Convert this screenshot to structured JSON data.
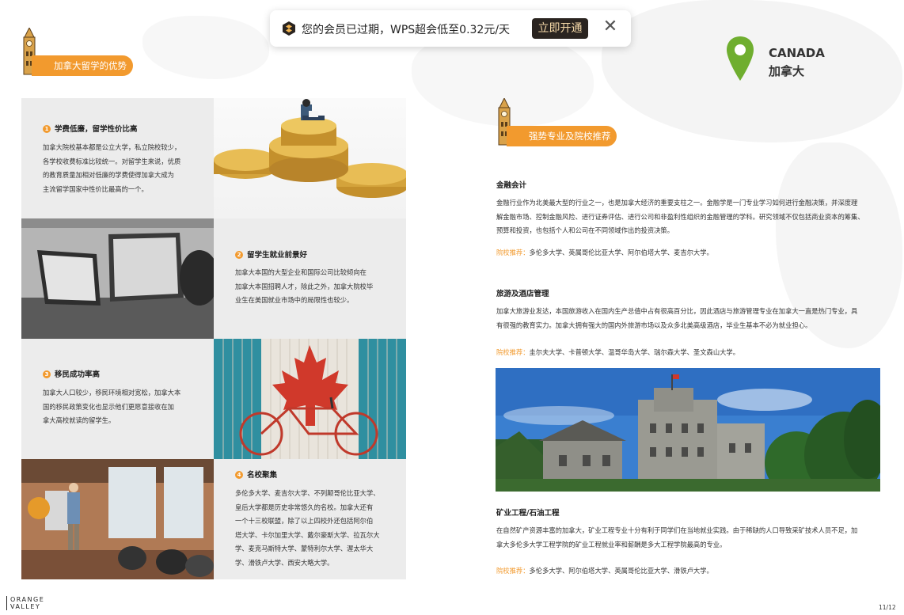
{
  "notification": {
    "message": "您的会员已过期，WPS超会低至0.32元/天",
    "action_label": "立即开通",
    "close_glyph": "✕"
  },
  "left_header": {
    "title": "加拿大留学的优势"
  },
  "advantages": [
    {
      "num": "1",
      "title": "学费低廉，留学性价比高",
      "body_lines": [
        "加拿大院校基本都是公立大学，私立院校较少，",
        "各学校收费标准比较统一。对留学生来说，优质",
        "的教育质量加相对低廉的学费使得加拿大成为",
        "主流留学国家中性价比最高的一个。"
      ]
    },
    {
      "num": "2",
      "title": "留学生就业前景好",
      "body_lines": [
        "加拿大本国的大型企业和国际公司比较倾向在",
        "加拿大本国招聘人才，除此之外，加拿大院校毕",
        "业生在美国就业市场中的局限性也较少。"
      ]
    },
    {
      "num": "3",
      "title": "移民成功率高",
      "body_lines": [
        "加拿大人口较少，移民环境相对宽松，加拿大本",
        "国的移民政策变化也显示他们更愿意接收在加",
        "拿大高校就读的留学生。"
      ]
    },
    {
      "num": "4",
      "title": "名校聚集",
      "body_lines": [
        "多伦多大学、麦吉尔大学、不列颠哥伦比亚大学、",
        "皇后大学都是历史非常悠久的名校。加拿大还有",
        "一个十三校联盟，除了以上四校外还包括阿尔伯",
        "塔大学、卡尔加里大学、戴尔豪斯大学、拉瓦尔大",
        "学、麦克马斯特大学、蒙特利尔大学、渥太华大",
        "学、滑铁卢大学、西安大略大学。"
      ]
    }
  ],
  "canada": {
    "en": "CANADA",
    "cn": "加拿大"
  },
  "right_header": {
    "title": "强势专业及院校推荐"
  },
  "majors": [
    {
      "title": "金融会计",
      "body_lines": [
        "金融行业作为北美最大型的行业之一，也是加拿大经济的重要支柱之一。金融学是一门专业学习如何进行金融决策，并深度理",
        "解金融市场、控制金融风险、进行证券评估、进行公司和非盈利性组织的金融管理的学科。研究领域不仅包括商业资本的筹集、",
        "预算和投资，也包括个人和公司在不同领域作出的投资决策。"
      ],
      "rec_label": "院校推荐：",
      "rec": "多伦多大学、英属哥伦比亚大学、阿尔伯塔大学、麦吉尔大学。"
    },
    {
      "title": "旅游及酒店管理",
      "body_lines": [
        "加拿大旅游业发达，本国旅游收入在国内生产总值中占有很高百分比，因此酒店与旅游管理专业在加拿大一直是热门专业，具",
        "有很强的教育实力。加拿大拥有强大的国内外旅游市场以及众多北美高级酒店，毕业生基本不必为就业担心。"
      ],
      "rec_label": "院校推荐：",
      "rec": "圭尔夫大学、卡普顿大学、温哥华岛大学、瑞尔森大学、圣文森山大学。"
    },
    {
      "title": "矿业工程/石油工程",
      "body_lines": [
        "在自然矿产资源丰富的加拿大，矿业工程专业十分有利于同学们在当地就业实践。由于稀缺的人口导致采矿技术人员不足，加",
        "拿大多伦多大学工程学院的矿业工程就业率和薪酬是多大工程学院最高的专业。"
      ],
      "rec_label": "院校推荐：",
      "rec": "多伦多大学、阿尔伯塔大学、英属哥伦比亚大学、滑铁卢大学。"
    }
  ],
  "footer": {
    "logo_line1": "ORANGE",
    "logo_line2": "VALLEY",
    "page": "11/12"
  },
  "colors": {
    "accent": "#f29a2e",
    "cell_bg": "#ececec",
    "tower": "#d9a24a"
  }
}
